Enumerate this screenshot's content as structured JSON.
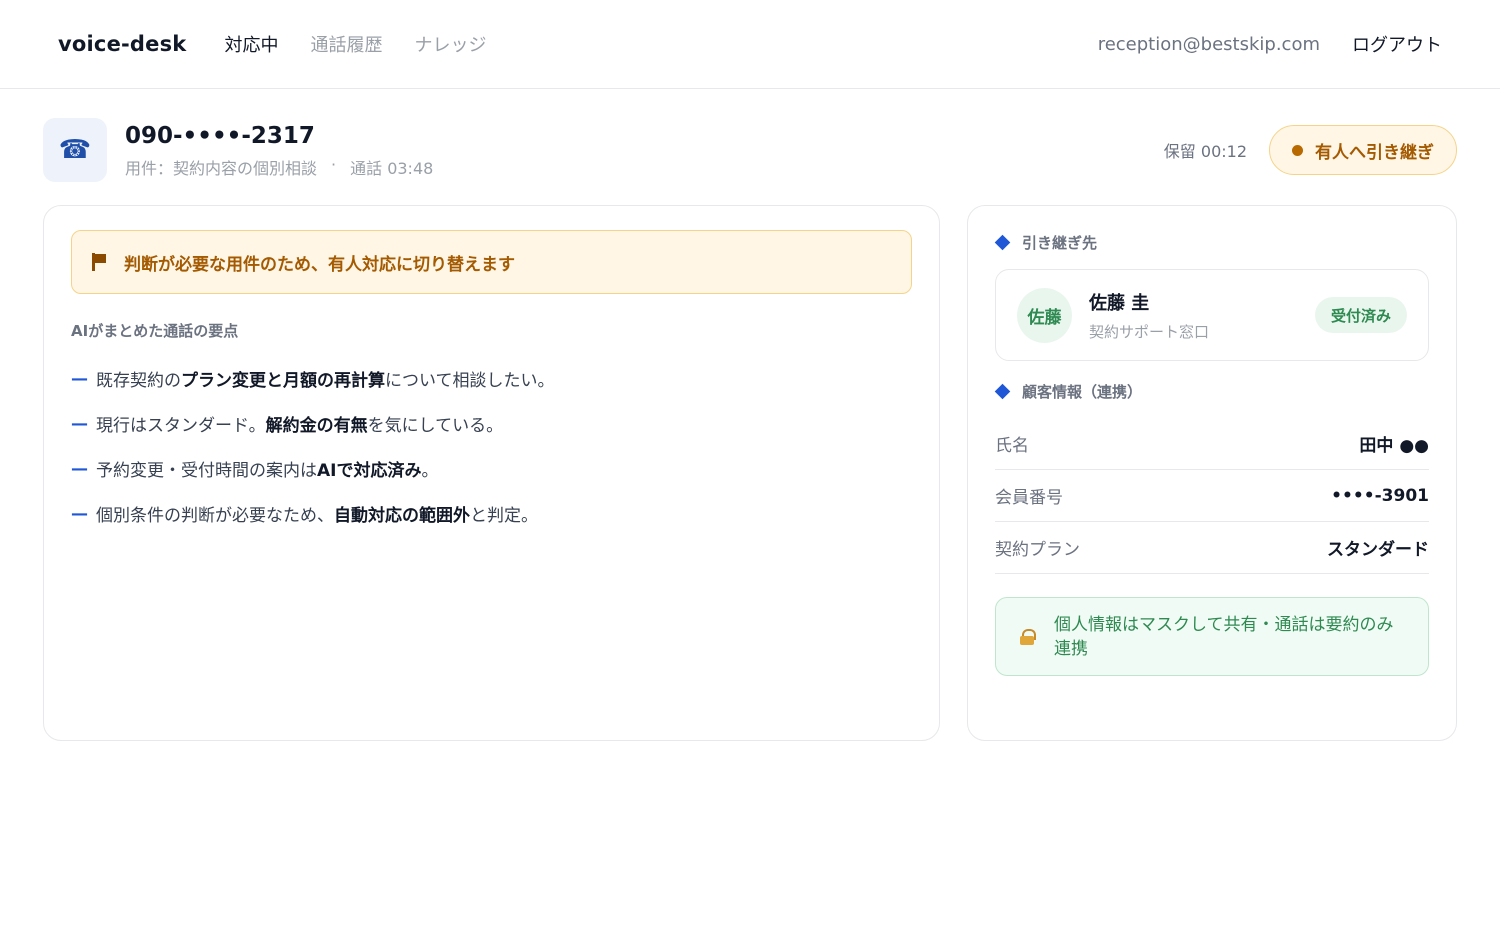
{
  "nav": {
    "brand": "voice-desk",
    "items": [
      {
        "label": "対応中",
        "active": true
      },
      {
        "label": "通話履歴",
        "active": false
      },
      {
        "label": "ナレッジ",
        "active": false
      }
    ],
    "user_email": "reception@bestskip.com",
    "logout_label": "ログアウト"
  },
  "call": {
    "icon": "phone-icon",
    "number": "090-••••-2317",
    "subject": "用件：契約内容の個別相談",
    "separator": "·",
    "duration": "通話 03:48",
    "hold": "保留 00:12",
    "handoff_label": "有人へ引き継ぎ"
  },
  "alert": {
    "icon": "flag-icon",
    "text": "判断が必要な用件のため、有人対応に切り替えます"
  },
  "summary": {
    "title": "AIがまとめた通話の要点",
    "items": [
      {
        "pre": "既存契約の",
        "bold": "プラン変更と月額の再計算",
        "post": "について相談したい。"
      },
      {
        "pre": "現行はスタンダード。",
        "bold": "解約金の有無",
        "post": "を気にしている。"
      },
      {
        "pre": "予約変更・受付時間の案内は",
        "bold": "AIで対応済み",
        "post": "。"
      },
      {
        "pre": "個別条件の判断が必要なため、",
        "bold": "自動対応の範囲外",
        "post": "と判定。"
      }
    ]
  },
  "handoff": {
    "section_label": "引き継ぎ先",
    "avatar_text": "佐藤",
    "name": "佐藤 圭",
    "department": "契約サポート窓口",
    "status": "受付済み"
  },
  "customer": {
    "section_label": "顧客情報（連携）",
    "rows": [
      {
        "key": "氏名",
        "value": "田中 ●●"
      },
      {
        "key": "会員番号",
        "value": "••••-3901"
      },
      {
        "key": "契約プラン",
        "value": "スタンダード"
      }
    ],
    "privacy_note": "個人情報はマスクして共有・通話は要約のみ連携"
  },
  "colors": {
    "accent": "#2057d6",
    "warning_bg": "#fff6e5",
    "warning_text": "#a35a00",
    "success_bg": "#e9f6ee",
    "success_text": "#2f8a52"
  }
}
